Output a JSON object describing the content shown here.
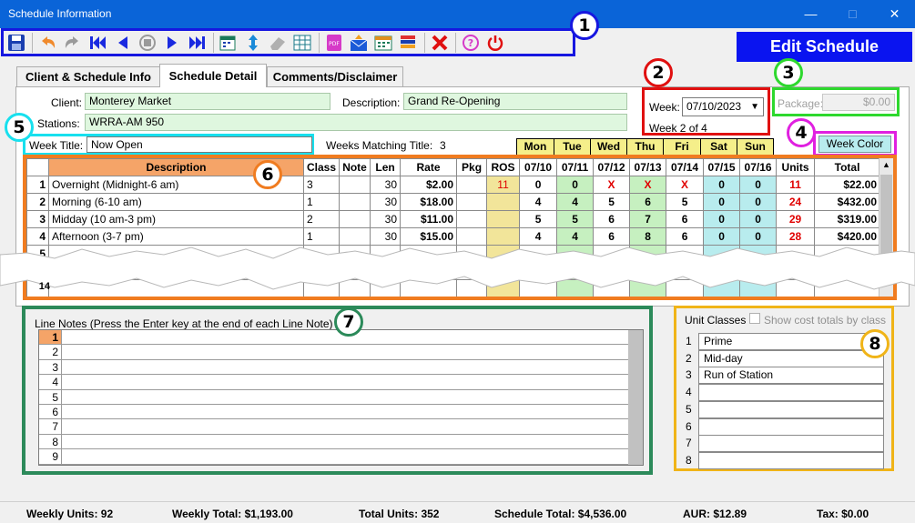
{
  "window": {
    "title": "Schedule Information"
  },
  "header": {
    "edit_schedule": "Edit Schedule"
  },
  "callouts": [
    "1",
    "2",
    "3",
    "4",
    "5",
    "6",
    "7",
    "8"
  ],
  "tabs": [
    {
      "label": "Client & Schedule Info"
    },
    {
      "label": "Schedule Detail"
    },
    {
      "label": "Comments/Disclaimer"
    }
  ],
  "form": {
    "client_label": "Client:",
    "client": "Monterey Market",
    "description_label": "Description:",
    "description": "Grand Re-Opening",
    "stations_label": "Stations:",
    "stations": "WRRA-AM 950",
    "week_label": "Week:",
    "week": "07/10/2023",
    "week_of": "Week 2 of 4",
    "package_label": "Package:",
    "package": "$0.00",
    "week_title_label": "Week Title:",
    "week_title": "Now Open",
    "weeks_matching_label": "Weeks Matching Title:",
    "weeks_matching": "3",
    "week_color": "Week Color"
  },
  "days": [
    "Mon",
    "Tue",
    "Wed",
    "Thu",
    "Fri",
    "Sat",
    "Sun"
  ],
  "grid": {
    "headers": [
      "Description",
      "Class",
      "Note",
      "Len",
      "Rate",
      "Pkg",
      "ROS",
      "07/10",
      "07/11",
      "07/12",
      "07/13",
      "07/14",
      "07/15",
      "07/16",
      "Units",
      "Total"
    ],
    "rows": [
      {
        "n": "1",
        "desc": "Overnight (Midnight-6 am)",
        "cls": "3",
        "note": "",
        "len": "30",
        "rate": "$2.00",
        "pkg": "",
        "ros": "11",
        "d": [
          "0",
          "0",
          "X",
          "X",
          "X",
          "0",
          "0"
        ],
        "units": "11",
        "total": "$22.00"
      },
      {
        "n": "2",
        "desc": "Morning (6-10 am)",
        "cls": "1",
        "note": "",
        "len": "30",
        "rate": "$18.00",
        "pkg": "",
        "ros": "",
        "d": [
          "4",
          "4",
          "5",
          "6",
          "5",
          "0",
          "0"
        ],
        "units": "24",
        "total": "$432.00"
      },
      {
        "n": "3",
        "desc": "Midday (10 am-3 pm)",
        "cls": "2",
        "note": "",
        "len": "30",
        "rate": "$11.00",
        "pkg": "",
        "ros": "",
        "d": [
          "5",
          "5",
          "6",
          "7",
          "6",
          "0",
          "0"
        ],
        "units": "29",
        "total": "$319.00"
      },
      {
        "n": "4",
        "desc": "Afternoon (3-7 pm)",
        "cls": "1",
        "note": "",
        "len": "30",
        "rate": "$15.00",
        "pkg": "",
        "ros": "",
        "d": [
          "4",
          "4",
          "6",
          "8",
          "6",
          "0",
          "0"
        ],
        "units": "28",
        "total": "$420.00"
      },
      {
        "n": "5",
        "desc": "",
        "cls": "",
        "note": "",
        "len": "",
        "rate": "",
        "pkg": "",
        "ros": "",
        "d": [
          "",
          "",
          "",
          "",
          "",
          "",
          ""
        ],
        "units": "",
        "total": ""
      }
    ],
    "last_row_number": "14"
  },
  "line_notes": {
    "title": "Line Notes (Press the Enter key at the end of each Line Note)",
    "rows": [
      "1",
      "2",
      "3",
      "4",
      "5",
      "6",
      "7",
      "8",
      "9"
    ]
  },
  "unit_classes": {
    "title": "Unit Classes",
    "show_cost_label": "Show cost totals by class",
    "rows": [
      {
        "n": "1",
        "v": "Prime"
      },
      {
        "n": "2",
        "v": "Mid-day"
      },
      {
        "n": "3",
        "v": "Run of Station"
      },
      {
        "n": "4",
        "v": ""
      },
      {
        "n": "5",
        "v": ""
      },
      {
        "n": "6",
        "v": ""
      },
      {
        "n": "7",
        "v": ""
      },
      {
        "n": "8",
        "v": ""
      }
    ]
  },
  "status": {
    "weekly_units": "Weekly Units: 92",
    "weekly_total": "Weekly Total: $1,193.00",
    "total_units": "Total Units: 352",
    "schedule_total": "Schedule Total: $4,536.00",
    "aur": "AUR: $12.89",
    "tax": "Tax: $0.00"
  },
  "colors": {
    "accent": "#0a14f0",
    "titlebar": "#0a64d8",
    "grid_border": "#f07c20",
    "notes_border": "#2c8a5a",
    "classes_border": "#f0b418"
  }
}
